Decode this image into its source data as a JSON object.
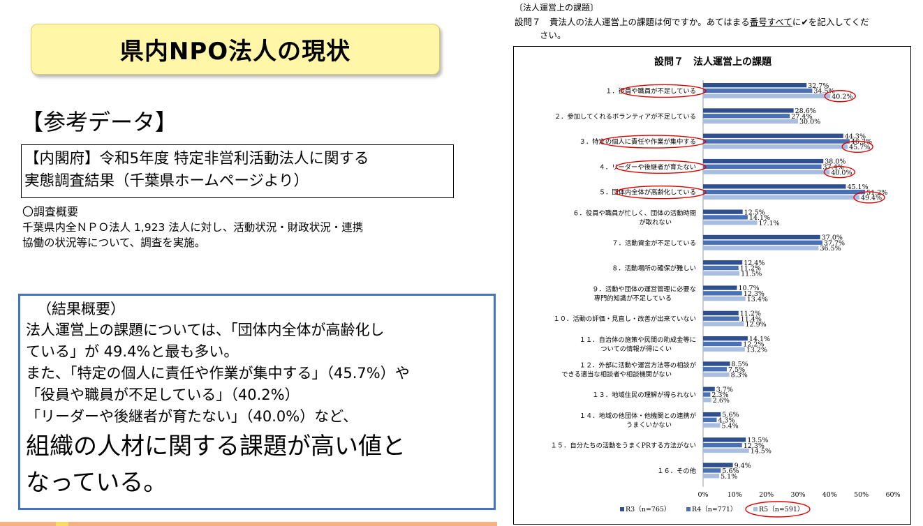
{
  "slide": {
    "title": "県内NPO法人の現状",
    "ref_heading": "【参考データ】",
    "source_line1": "【内閣府】令和5年度 特定非営利活動法人に関する",
    "source_line2": "実態調査結果（千葉県ホームページより）",
    "overview_title": "〇調査概要",
    "overview_line1": "千葉県内全ＮＰＯ法人 1,923 法人に対し、活動状況・財政状況・連携",
    "overview_line2": "協働の状況等について、調査を実施。",
    "result_lines": [
      "（結果概要）",
      "法人運営上の課題については、「団体内全体が高齢化し",
      "ている」が 49.4%と最も多い。",
      "また、「特定の個人に責任や作業が集中する」（45.7%）や",
      "「役員や職員が不足している」（40.2%）",
      "「リーダーや後継者が育たない」（40.0%）など、",
      "組織の人材に関する課題が高い値と",
      "なっている。"
    ]
  },
  "question": {
    "section": "〔法人運営上の課題〕",
    "text_a": "設問７　貴法人の法人運営上の課題は何ですか。あてはまる",
    "text_u": "番号すべて",
    "text_b": "に✔を記入してくだ",
    "text_c": "さい。"
  },
  "chart_data": {
    "type": "bar",
    "orientation": "horizontal",
    "title": "設問７　法人運営上の課題",
    "categories": [
      [
        "１．役員や職員が不足している"
      ],
      [
        "２．参加してくれるボランティアが不足している"
      ],
      [
        "３．特定の個人に責任や作業が集中する"
      ],
      [
        "４．リーダーや後継者が育たない"
      ],
      [
        "５．団体内全体が高齢化している"
      ],
      [
        "６．役員や職員が忙しく、団体の活動時間",
        "が取れない"
      ],
      [
        "７．活動資金が不足している"
      ],
      [
        "８．活動場所の確保が難しい"
      ],
      [
        "９．活動や団体の運営管理に必要な",
        "専門的知識が不足している"
      ],
      [
        "１０．活動の評価・見直し・改善が出来ていない"
      ],
      [
        "１１．自治体の施策や民間の助成金等に",
        "ついての情報が得にくい"
      ],
      [
        "１２．外部に活動や運営方法等の相談が",
        "できる適当な相談者や相談機関がない"
      ],
      [
        "１３．地域住民の理解が得られない"
      ],
      [
        "１４．地域の他団体・他機関との連携が",
        "うまくいかない"
      ],
      [
        "１５．自分たちの活動をうまくPRする方法がない"
      ],
      [
        "１６．その他"
      ]
    ],
    "series": [
      {
        "name": "R3（n=765）",
        "color": "#2f4f8f",
        "values": [
          32.7,
          28.6,
          44.3,
          38.0,
          45.1,
          12.5,
          37.0,
          12.4,
          10.7,
          11.2,
          14.1,
          8.5,
          3.7,
          5.6,
          13.5,
          9.4
        ]
      },
      {
        "name": "R4（n=771）",
        "color": "#4a70b5",
        "values": [
          34.5,
          27.4,
          46.3,
          37.4,
          51.2,
          14.1,
          37.7,
          11.2,
          12.3,
          11.4,
          12.2,
          7.5,
          2.3,
          4.3,
          12.3,
          5.6
        ]
      },
      {
        "name": "R5（n=591）",
        "color": "#a9bde0",
        "values": [
          40.2,
          30.0,
          45.7,
          40.0,
          49.4,
          17.1,
          36.5,
          11.5,
          13.4,
          12.9,
          13.2,
          8.3,
          2.6,
          5.4,
          14.5,
          5.1
        ]
      }
    ],
    "xlim": [
      0,
      60
    ],
    "xticks": [
      "0%",
      "10%",
      "20%",
      "30%",
      "40%",
      "50%",
      "60%"
    ],
    "value_suffix": "%",
    "legend_position": "bottom",
    "highlighted_categories": [
      0,
      2,
      3,
      4
    ],
    "highlighted_series": 2,
    "highlight_color": "#e00000"
  }
}
